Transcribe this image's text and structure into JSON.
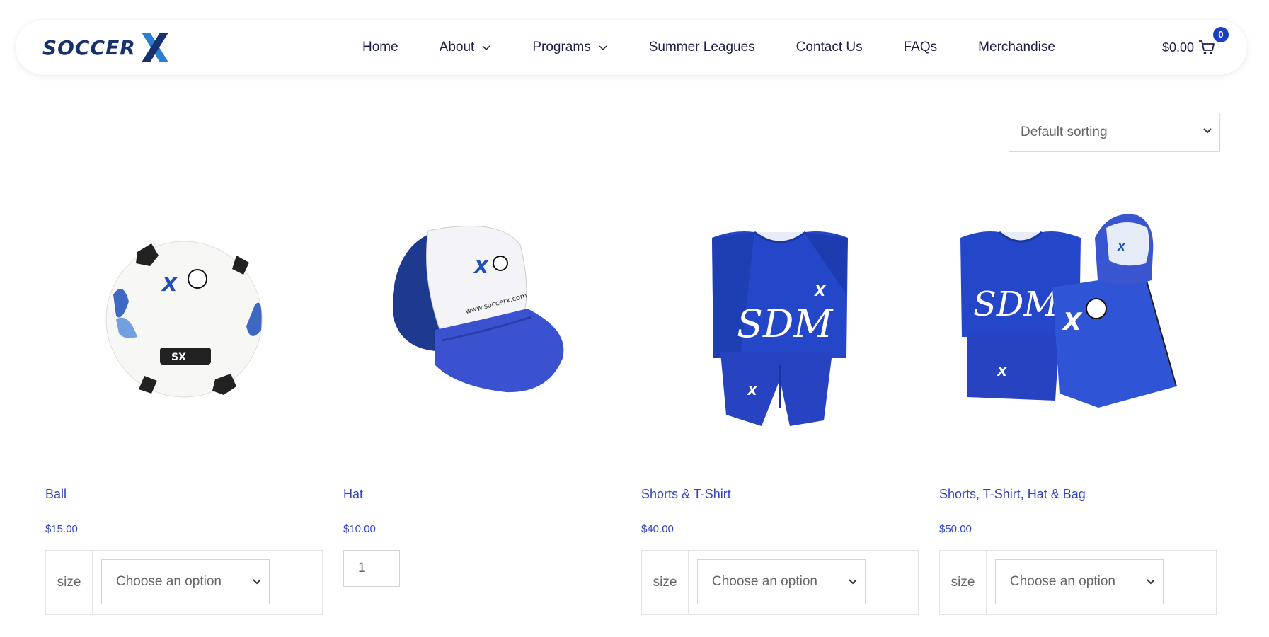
{
  "header": {
    "logo_text": "SOCCER",
    "logo_mark": "X",
    "nav": [
      {
        "label": "Home",
        "has_dropdown": false
      },
      {
        "label": "About",
        "has_dropdown": true
      },
      {
        "label": "Programs",
        "has_dropdown": true
      },
      {
        "label": "Summer Leagues",
        "has_dropdown": false
      },
      {
        "label": "Contact Us",
        "has_dropdown": false
      },
      {
        "label": "FAQs",
        "has_dropdown": false
      },
      {
        "label": "Merchandise",
        "has_dropdown": false
      }
    ],
    "cart": {
      "total": "$0.00",
      "count": "0",
      "icon": "cart-icon"
    }
  },
  "sorting": {
    "selected": "Default sorting"
  },
  "products": [
    {
      "name": "Ball",
      "price": "$15.00",
      "image": "soccer-ball",
      "variation_label": "size",
      "variation_value": "Choose an option"
    },
    {
      "name": "Hat",
      "price": "$10.00",
      "image": "trucker-hat",
      "quantity": "1"
    },
    {
      "name": "Shorts & T-Shirt",
      "price": "$40.00",
      "image": "jersey-and-shorts",
      "variation_label": "size",
      "variation_value": "Choose an option"
    },
    {
      "name": "Shorts, T-Shirt, Hat & Bag",
      "price": "$50.00",
      "image": "kit-bundle",
      "variation_label": "size",
      "variation_value": "Choose an option"
    }
  ],
  "colors": {
    "brand_navy": "#17306e",
    "brand_blue": "#1a3fbf",
    "link_blue": "#3043c4"
  }
}
